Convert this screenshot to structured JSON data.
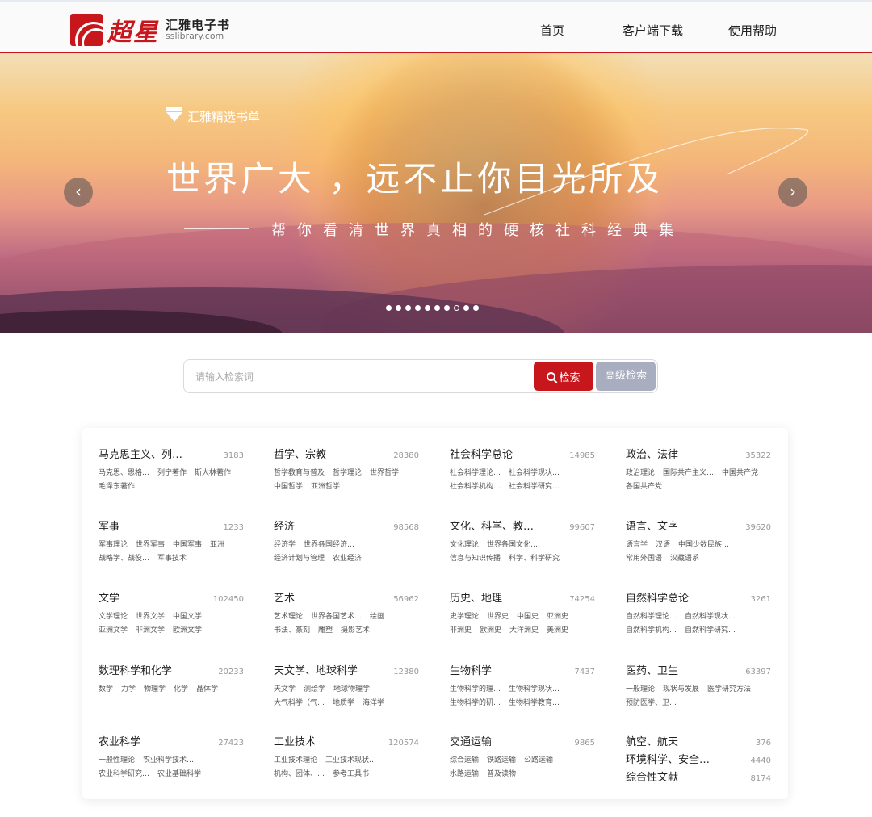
{
  "header": {
    "logo_mark": "超星",
    "logo_title": "汇雅电子书",
    "logo_sub": "sslibrary.com",
    "nav": [
      "首页",
      "客户端下载",
      "使用帮助"
    ]
  },
  "banner": {
    "tag": "汇雅精选书单",
    "headline": "世界广大 ，远不止你目光所及",
    "subline": "帮你看清世界真相的硬核社科经典集",
    "prev": "‹",
    "next": "›",
    "active_slide": 8,
    "slide_count": 10
  },
  "search": {
    "placeholder": "请输入检索词",
    "button": "检索",
    "advanced": "高级检索"
  },
  "categories": [
    {
      "name": "马克思主义、列…",
      "count": "3183",
      "subs": [
        "马克思、恩格…",
        "列宁著作",
        "斯大林著作",
        "毛泽东著作"
      ]
    },
    {
      "name": "哲学、宗教",
      "count": "28380",
      "subs": [
        "哲学教育与普及",
        "哲学理论",
        "世界哲学",
        "中国哲学",
        "亚洲哲学"
      ]
    },
    {
      "name": "社会科学总论",
      "count": "14985",
      "subs": [
        "社会科学理论…",
        "社会科学现状…",
        "社会科学机构…",
        "社会科学研究…"
      ]
    },
    {
      "name": "政治、法律",
      "count": "35322",
      "subs": [
        "政治理论",
        "国际共产主义…",
        "中国共产党",
        "各国共产党"
      ]
    },
    {
      "name": "军事",
      "count": "1233",
      "subs": [
        "军事理论",
        "世界军事",
        "中国军事",
        "亚洲",
        "战略学、战役…",
        "军事技术"
      ]
    },
    {
      "name": "经济",
      "count": "98568",
      "subs": [
        "经济学",
        "世界各国经济…",
        "经济计划与管理",
        "农业经济"
      ]
    },
    {
      "name": "文化、科学、教…",
      "count": "99607",
      "subs": [
        "文化理论",
        "世界各国文化…",
        "信息与知识传播",
        "科学、科学研究"
      ]
    },
    {
      "name": "语言、文字",
      "count": "39620",
      "subs": [
        "语言学",
        "汉语",
        "中国少数民族…",
        "常用外国语",
        "汉藏语系"
      ]
    },
    {
      "name": "文学",
      "count": "102450",
      "subs": [
        "文学理论",
        "世界文学",
        "中国文学",
        "亚洲文学",
        "非洲文学",
        "欧洲文学"
      ]
    },
    {
      "name": "艺术",
      "count": "56962",
      "subs": [
        "艺术理论",
        "世界各国艺术…",
        "绘画",
        "书法、篆刻",
        "雕塑",
        "摄影艺术"
      ]
    },
    {
      "name": "历史、地理",
      "count": "74254",
      "subs": [
        "史学理论",
        "世界史",
        "中国史",
        "亚洲史",
        "非洲史",
        "欧洲史",
        "大洋洲史",
        "美洲史"
      ]
    },
    {
      "name": "自然科学总论",
      "count": "3261",
      "subs": [
        "自然科学理论…",
        "自然科学现状…",
        "自然科学机构…",
        "自然科学研究…"
      ]
    },
    {
      "name": "数理科学和化学",
      "count": "20233",
      "subs": [
        "数学",
        "力学",
        "物理学",
        "化学",
        "晶体学"
      ]
    },
    {
      "name": "天文学、地球科学",
      "count": "12380",
      "subs": [
        "天文学",
        "测绘学",
        "地球物理学",
        "大气科学（气…",
        "地质学",
        "海洋学"
      ]
    },
    {
      "name": "生物科学",
      "count": "7437",
      "subs": [
        "生物科学的理…",
        "生物科学现状…",
        "生物科学的研…",
        "生物科学教育…"
      ]
    },
    {
      "name": "医药、卫生",
      "count": "63397",
      "subs": [
        "一般理论",
        "现状与发展",
        "医学研究方法",
        "预防医学、卫…"
      ]
    },
    {
      "name": "农业科学",
      "count": "27423",
      "subs": [
        "一般性理论",
        "农业科学技术…",
        "农业科学研究…",
        "农业基础科学"
      ]
    },
    {
      "name": "工业技术",
      "count": "120574",
      "subs": [
        "工业技术理论",
        "工业技术现状…",
        "机构、团体、…",
        "参考工具书"
      ]
    },
    {
      "name": "交通运输",
      "count": "9865",
      "subs": [
        "综合运输",
        "铁路运输",
        "公路运输",
        "水路运输",
        "普及读物"
      ]
    }
  ],
  "mini_categories": [
    {
      "name": "航空、航天",
      "count": "376"
    },
    {
      "name": "环境科学、安全…",
      "count": "4440"
    },
    {
      "name": "综合性文献",
      "count": "8174"
    }
  ]
}
